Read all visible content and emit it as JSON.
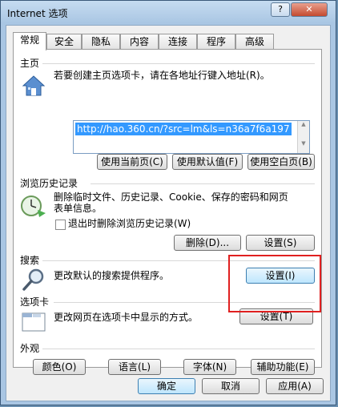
{
  "window": {
    "title": "Internet 选项",
    "help": "?",
    "close": "✕"
  },
  "tabs": [
    "常规",
    "安全",
    "隐私",
    "内容",
    "连接",
    "程序",
    "高级"
  ],
  "home": {
    "heading": "主页",
    "description": "若要创建主页选项卡，请在各地址行键入地址(R)。",
    "url": "http://hao.360.cn/?src=lm&ls=n36a7f6a197",
    "buttons": [
      "使用当前页(C)",
      "使用默认值(F)",
      "使用空白页(B)"
    ]
  },
  "history": {
    "heading": "浏览历史记录",
    "description_line1": "删除临时文件、历史记录、Cookie、保存的密码和网页",
    "description_line2": "表单信息。",
    "checkbox_label": "退出时删除浏览历史记录(W)",
    "delete_button": "删除(D)...",
    "settings_button": "设置(S)"
  },
  "search": {
    "heading": "搜索",
    "description": "更改默认的搜索提供程序。",
    "settings_button": "设置(I)"
  },
  "tabs_section": {
    "heading": "选项卡",
    "description": "更改网页在选项卡中显示的方式。",
    "settings_button": "设置(T)"
  },
  "appearance": {
    "heading": "外观",
    "buttons": [
      "颜色(O)",
      "语言(L)",
      "字体(N)",
      "辅助功能(E)"
    ]
  },
  "footer": {
    "ok": "确定",
    "cancel": "取消",
    "apply": "应用(A)"
  },
  "colors": {
    "highlight": "#e02020",
    "selection": "#3399ff",
    "title_bar": "#a9c6e3"
  }
}
